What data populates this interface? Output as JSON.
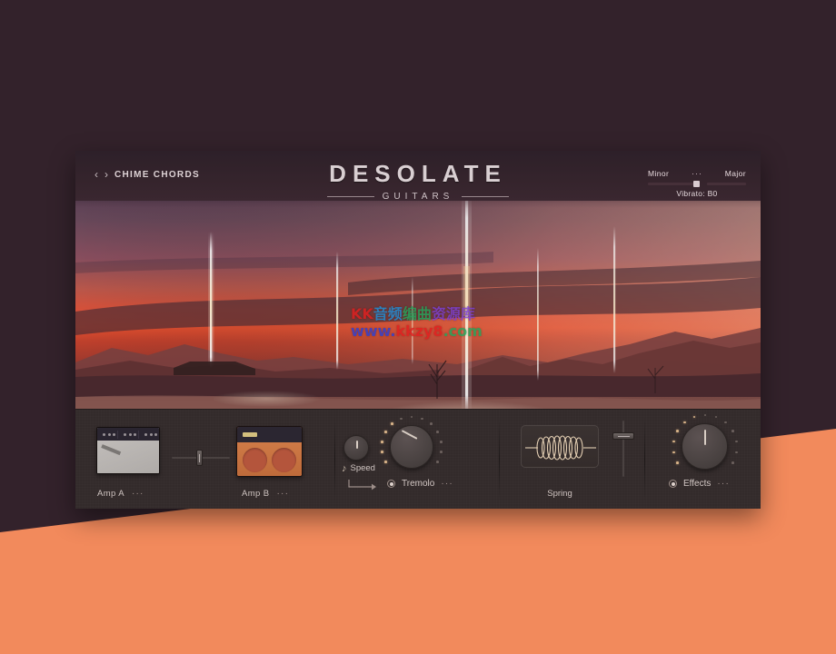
{
  "page": {
    "background_color": "#33222b",
    "accent_shape_color": "#f28a5c"
  },
  "plugin": {
    "header": {
      "prev_icon": "‹",
      "next_icon": "›",
      "preset_name": "CHIME CHORDS",
      "brand_title": "DESOLATE",
      "brand_subtitle": "GUITARS",
      "mode": {
        "left_label": "Minor",
        "dots": "···",
        "right_label": "Major",
        "vibrato_label": "Vibrato: B0"
      }
    },
    "artwork": {
      "description": "desert-sunset-landscape",
      "sky_top_color": "#6b4e63",
      "sky_glow_color": "#e8472f",
      "ground_color": "#c6938c",
      "beam_color": "#fff6e8"
    },
    "watermark": {
      "line1_parts": [
        {
          "text": "KK",
          "color": "#e01f1f"
        },
        {
          "text": "音频",
          "color": "#1f8fd8"
        },
        {
          "text": "编曲",
          "color": "#22a65b"
        },
        {
          "text": "资源库",
          "color": "#7b3fd4"
        }
      ],
      "line2_parts": [
        {
          "text": "www.",
          "color": "#2d3fd0"
        },
        {
          "text": "kkzy8",
          "color": "#e01f1f"
        },
        {
          "text": ".",
          "color": "#22a65b"
        },
        {
          "text": "com",
          "color": "#22a65b"
        }
      ]
    },
    "rack": {
      "amps": {
        "amp_a_label": "Amp A",
        "amp_a_menu": "···",
        "amp_b_label": "Amp B",
        "amp_b_menu": "···",
        "crossfader_name": "amp-crossfader"
      },
      "tremolo": {
        "speed_label": "Speed",
        "speed_icon": "♪",
        "toggle_label": "Tremolo",
        "menu": "···"
      },
      "spring": {
        "label": "Spring"
      },
      "effects": {
        "label": "Effects",
        "menu": "···"
      }
    }
  }
}
